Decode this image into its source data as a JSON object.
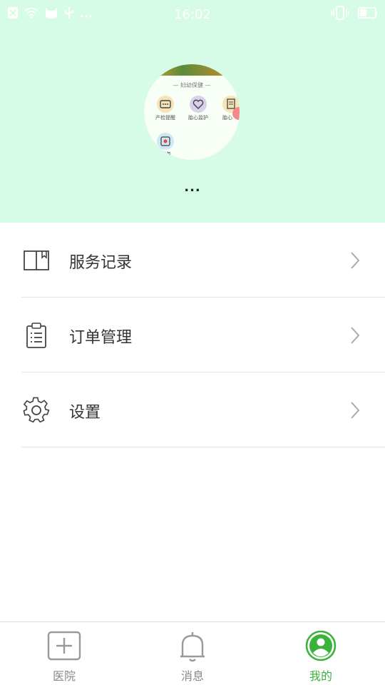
{
  "status_bar": {
    "time": "16:02",
    "icons_left": [
      "notification-icon",
      "wifi-icon",
      "cat-app-icon",
      "usb-icon",
      "more-icon"
    ],
    "icons_right": [
      "vibrate-icon",
      "battery-icon"
    ]
  },
  "profile": {
    "username": "...",
    "avatar_section_title": "— 妇幼保健 —",
    "avatar_items": [
      "产检提醒",
      "胎心监护",
      "胎心",
      "服务"
    ]
  },
  "menu": {
    "items": [
      {
        "label": "服务记录",
        "icon": "book-icon"
      },
      {
        "label": "订单管理",
        "icon": "clipboard-icon"
      },
      {
        "label": "设置",
        "icon": "gear-icon"
      }
    ]
  },
  "bottom_nav": {
    "items": [
      {
        "label": "医院",
        "icon": "hospital-icon",
        "active": false
      },
      {
        "label": "消息",
        "icon": "bell-icon",
        "active": false
      },
      {
        "label": "我的",
        "icon": "user-icon",
        "active": true
      }
    ]
  },
  "colors": {
    "header_bg": "#d6fbe6",
    "accent": "#3bb33b",
    "text": "#333333",
    "nav_inactive": "#888888"
  }
}
